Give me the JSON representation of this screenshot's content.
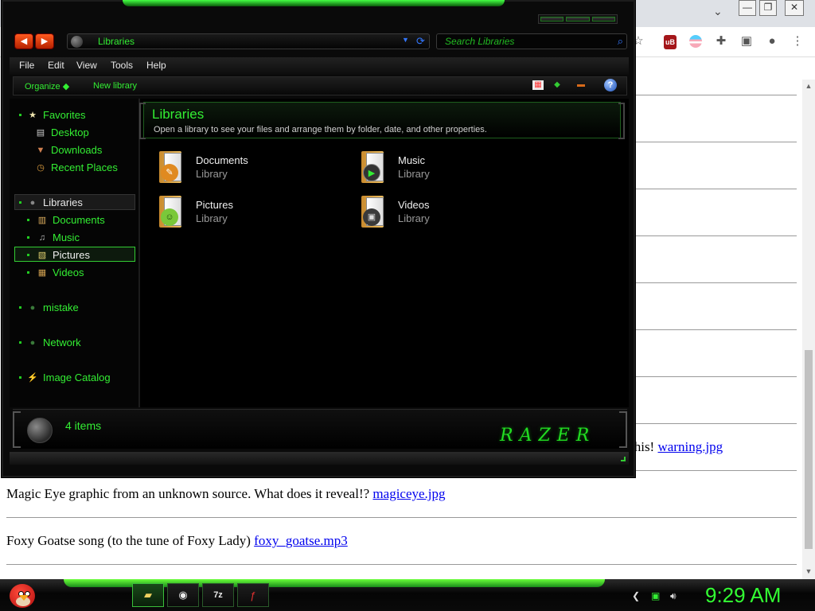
{
  "browser": {
    "window_controls": [
      "—",
      "❐",
      "✕"
    ],
    "tab_dropdown": "⌄",
    "toolbar_icons": [
      "star-icon",
      "ublock-icon",
      "flag-extension-icon",
      "puzzle-icon",
      "sidepanel-icon",
      "profile-icon",
      "menu-icon"
    ],
    "rows": [
      {
        "prefix": "this! ",
        "link": "warning.jpg"
      },
      {
        "prefix": "Magic Eye graphic from an unknown source. What does it reveal!? ",
        "link": "magiceye.jpg"
      },
      {
        "prefix": "Foxy Goatse song (to the tune of Foxy Lady) ",
        "link": "foxy_goatse.mp3"
      }
    ]
  },
  "explorer": {
    "address": "Libraries",
    "search_placeholder": "Search Libraries",
    "menu": [
      "File",
      "Edit",
      "View",
      "Tools",
      "Help"
    ],
    "commands": {
      "organize": "Organize",
      "new_library": "New library"
    },
    "nav": {
      "favorites": "Favorites",
      "desktop": "Desktop",
      "downloads": "Downloads",
      "recent": "Recent Places",
      "libraries": "Libraries",
      "documents": "Documents",
      "music": "Music",
      "pictures": "Pictures",
      "videos": "Videos",
      "mistake": "mistake",
      "network": "Network",
      "image_catalog": "Image Catalog"
    },
    "header": {
      "title": "Libraries",
      "subtitle": "Open a library to see your files and arrange them by folder, date, and other properties."
    },
    "libraries": [
      {
        "name": "Documents",
        "type": "Library",
        "icon": "documents-library-icon"
      },
      {
        "name": "Music",
        "type": "Library",
        "icon": "music-library-icon"
      },
      {
        "name": "Pictures",
        "type": "Library",
        "icon": "pictures-library-icon"
      },
      {
        "name": "Videos",
        "type": "Library",
        "icon": "videos-library-icon"
      }
    ],
    "details": {
      "count": "4 items",
      "logo": "RAZER"
    },
    "accent": "#33ee33"
  },
  "taskbar": {
    "apps": [
      "explorer-icon",
      "chrome-icon",
      "7zip-icon",
      "flash-icon"
    ],
    "seven_zip_label": "7z",
    "clock": "9:29 AM"
  }
}
